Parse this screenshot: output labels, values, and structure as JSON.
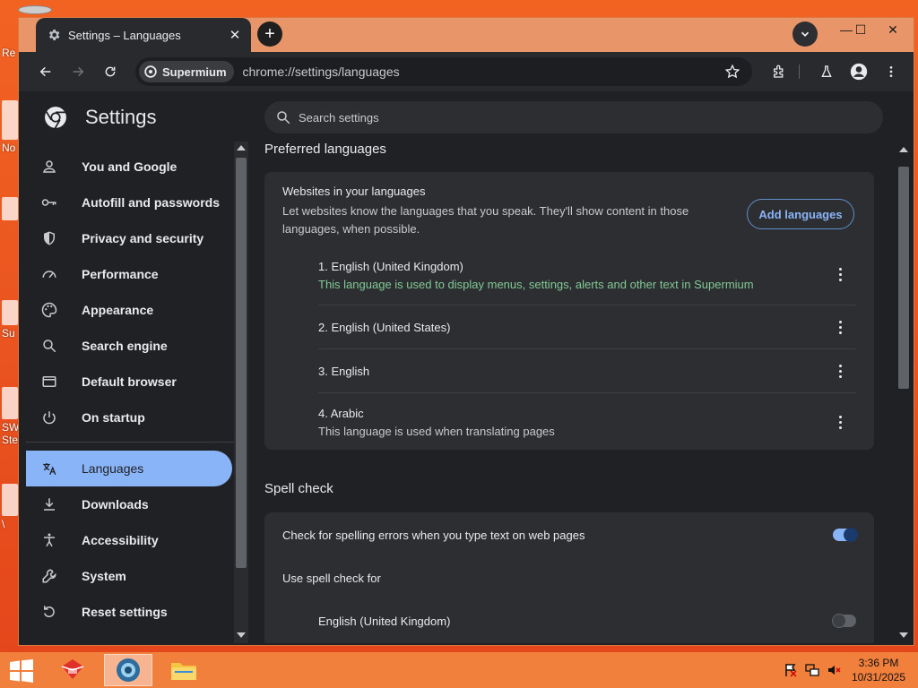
{
  "desktop": {
    "peek_labels": [
      "Re",
      "No",
      "Su",
      "SW",
      "Ste",
      "\\"
    ]
  },
  "window": {
    "tab_title": "Settings – Languages",
    "tab_close": "✕",
    "new_tab": "+",
    "controls": {
      "minimize": "—",
      "maximize": "☐",
      "close": "✕"
    }
  },
  "toolbar": {
    "chip_label": "Supermium",
    "url": "chrome://settings/languages"
  },
  "settings": {
    "title": "Settings",
    "search_placeholder": "Search settings"
  },
  "sidebar": {
    "items": [
      {
        "label": "You and Google",
        "icon": "person-icon"
      },
      {
        "label": "Autofill and passwords",
        "icon": "key-icon"
      },
      {
        "label": "Privacy and security",
        "icon": "shield-icon"
      },
      {
        "label": "Performance",
        "icon": "speedometer-icon"
      },
      {
        "label": "Appearance",
        "icon": "palette-icon"
      },
      {
        "label": "Search engine",
        "icon": "search-icon"
      },
      {
        "label": "Default browser",
        "icon": "browser-window-icon"
      },
      {
        "label": "On startup",
        "icon": "power-icon"
      },
      {
        "label": "Languages",
        "icon": "translate-icon",
        "active": true
      },
      {
        "label": "Downloads",
        "icon": "download-icon"
      },
      {
        "label": "Accessibility",
        "icon": "accessibility-icon"
      },
      {
        "label": "System",
        "icon": "wrench-icon"
      },
      {
        "label": "Reset settings",
        "icon": "reset-icon"
      }
    ]
  },
  "preferred_languages": {
    "section_title": "Preferred languages",
    "card_heading": "Websites in your languages",
    "card_description": "Let websites know the languages that you speak. They'll show content in those languages, when possible.",
    "add_button": "Add languages",
    "languages": [
      {
        "name": "1. English (United Kingdom)",
        "note": "This language is used to display menus, settings, alerts and other text in Supermium"
      },
      {
        "name": "2. English (United States)",
        "note": ""
      },
      {
        "name": "3. English",
        "note": ""
      },
      {
        "name": "4. Arabic",
        "note": "This language is used when translating pages"
      }
    ]
  },
  "spell_check": {
    "section_title": "Spell check",
    "enable_label": "Check for spelling errors when you type text on web pages",
    "enable_on": true,
    "use_for_label": "Use spell check for",
    "languages": [
      {
        "name": "English (United Kingdom)",
        "on": false
      }
    ]
  },
  "taskbar": {
    "time": "3:36 PM",
    "date": "10/31/2025"
  },
  "colors": {
    "accent": "#8ab4f8",
    "note_green": "#81c995",
    "desktop": "#e8541f",
    "taskbar": "#f1803d"
  }
}
